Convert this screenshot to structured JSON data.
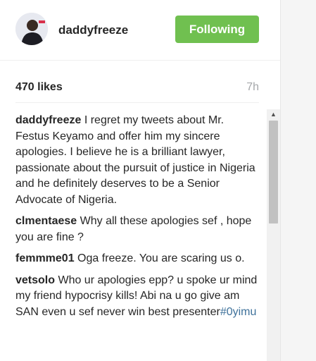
{
  "header": {
    "username": "daddyfreeze",
    "follow_label": "Following"
  },
  "post": {
    "likes": "470 likes",
    "time": "7h"
  },
  "comments": [
    {
      "user": "daddyfreeze",
      "text": " I regret my tweets about Mr. Festus Keyamo and offer him my sincere apologies. I believe he is a brilliant lawyer, passionate about the pursuit of justice in Nigeria and he definitely deserves to be a Senior Advocate of Nigeria."
    },
    {
      "user": "clmentaese",
      "text": " Why all these apologies sef , hope you are fine ?"
    },
    {
      "user": "femmme01",
      "text": " Oga freeze. You are scaring us o."
    },
    {
      "user": "vetsolo",
      "text": " Who ur apologies epp? u spoke ur mind my friend hypocrisy kills! Abi na u go give am SAN even u sef never win best presenter",
      "hashtag": "#0yimu"
    }
  ],
  "scrollbar": {
    "up_arrow": "▲"
  }
}
